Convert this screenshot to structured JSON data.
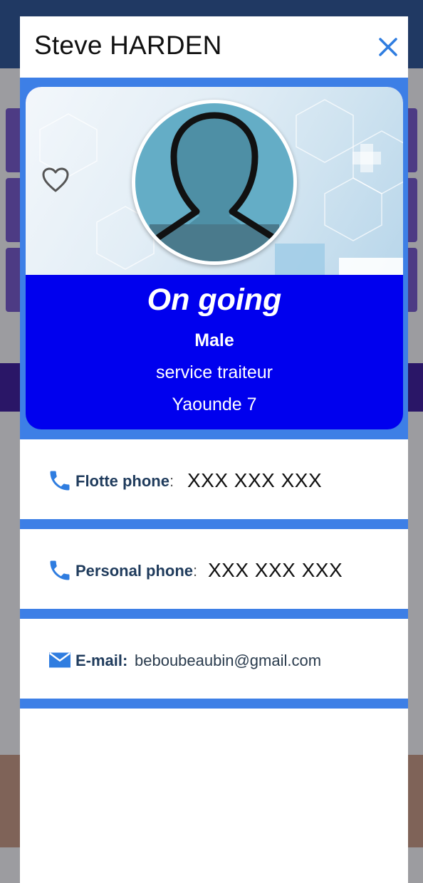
{
  "modal": {
    "title": "Steve HARDEN",
    "close_icon": "close-icon"
  },
  "profile": {
    "avatar_icon": "person-avatar-icon",
    "favorite_icon": "heart-outline-icon",
    "status": "On going",
    "gender": "Male",
    "service": "service traiteur",
    "location": "Yaounde 7"
  },
  "contacts": {
    "fleet_phone": {
      "icon": "phone-icon",
      "label": "Flotte phone",
      "separator": ":",
      "value": "XXX XXX XXX"
    },
    "personal_phone": {
      "icon": "phone-icon",
      "label": "Personal phone",
      "separator": ":",
      "value": "XXX XXX XXX"
    },
    "email": {
      "icon": "mail-icon",
      "label": "E-mail",
      "separator": ":",
      "value": "beboubeaubin@gmail.com"
    }
  },
  "colors": {
    "accent_blue": "#3d7fe6",
    "card_blue": "#0000ee",
    "avatar_bg": "#64adc6",
    "icon_blue": "#2f7de0"
  }
}
